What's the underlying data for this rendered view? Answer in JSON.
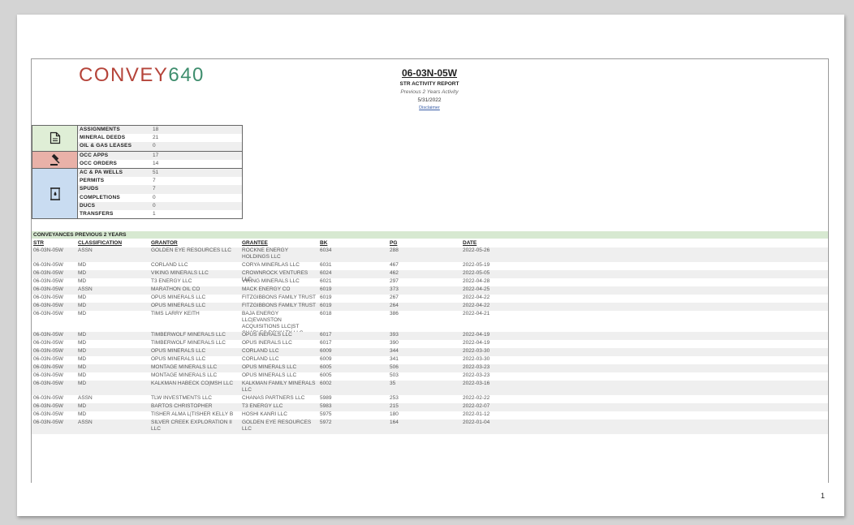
{
  "logo": {
    "part1": "CONVEY",
    "part2": "640"
  },
  "header": {
    "title": "06-03N-05W",
    "subtitle": "STR ACTIVITY REPORT",
    "note": "Previous 2 Years Activity",
    "date": "5/31/2022",
    "disclaimer": "Disclaimer"
  },
  "summary": {
    "groups": [
      {
        "icon": "document-icon",
        "color": "#dfeed6",
        "rows": [
          {
            "label": "ASSIGNMENTS",
            "value": "18"
          },
          {
            "label": "MINERAL DEEDS",
            "value": "21"
          },
          {
            "label": "OIL & GAS LEASES",
            "value": "0"
          }
        ]
      },
      {
        "icon": "gavel-icon",
        "color": "#e9b1a8",
        "rows": [
          {
            "label": "OCC APPS",
            "value": "17"
          },
          {
            "label": "OCC ORDERS",
            "value": "14"
          }
        ]
      },
      {
        "icon": "oil-barrel-icon",
        "color": "#c9dcf1",
        "rows": [
          {
            "label": "AC & PA WELLS",
            "value": "51"
          },
          {
            "label": "PERMITS",
            "value": "7"
          },
          {
            "label": "SPUDS",
            "value": "7"
          },
          {
            "label": "COMPLETIONS",
            "value": "0"
          },
          {
            "label": "DUCS",
            "value": "0"
          },
          {
            "label": "TRANSFERS",
            "value": "1"
          }
        ]
      }
    ]
  },
  "conveyances": {
    "title": "CONVEYANCES PREVIOUS 2 YEARS",
    "columns": [
      "STR",
      "CLASSIFICATION",
      "GRANTOR",
      "GRANTEE",
      "BK",
      "PG",
      "DATE"
    ],
    "rows": [
      [
        "06-03N-05W",
        "ASSN",
        "GOLDEN EYE RESOURCES LLC",
        "ROCKNE ENERGY HOLDINGS LLC",
        "6034",
        "288",
        "2022-05-26"
      ],
      [
        "06-03N-05W",
        "MD",
        "CORLAND LLC",
        "CORYA MINERLAS LLC",
        "6031",
        "467",
        "2022-05-19"
      ],
      [
        "06-03N-05W",
        "MD",
        "VIKING MINERALS LLC",
        "CROWNROCK VENTURES LLC",
        "6024",
        "462",
        "2022-05-05"
      ],
      [
        "06-03N-05W",
        "MD",
        "T3 ENERGY LLC",
        "VIKING MINERALS LLC",
        "6021",
        "297",
        "2022-04-28"
      ],
      [
        "06-03N-05W",
        "ASSN",
        "MARATHON OIL CO",
        "MACK ENERGY CO",
        "6019",
        "373",
        "2022-04-25"
      ],
      [
        "06-03N-05W",
        "MD",
        "OPUS MINERALS LLC",
        "FITZGIBBONS FAMILY TRUST",
        "6019",
        "267",
        "2022-04-22"
      ],
      [
        "06-03N-05W",
        "MD",
        "OPUS MINERALS LLC",
        "FITZGIBBONS FAMILY TRUST",
        "6019",
        "264",
        "2022-04-22"
      ],
      [
        "06-03N-05W",
        "MD",
        "TIMS LARRY KEITH",
        "BAJA ENERGY LLC|EVANSTON ACQUISITIONS LLC|ST CHARLES ROYALTY LLC",
        "6018",
        "386",
        "2022-04-21"
      ],
      [
        "06-03N-05W",
        "MD",
        "TIMBERWOLF MINERALS LLC",
        "OPUS INERALS LLC",
        "6017",
        "393",
        "2022-04-19"
      ],
      [
        "06-03N-05W",
        "MD",
        "TIMBERWOLF MINERALS LLC",
        "OPUS INERALS LLC",
        "6017",
        "390",
        "2022-04-19"
      ],
      [
        "06-03N-05W",
        "MD",
        "OPUS MINERALS LLC",
        "CORLAND LLC",
        "6009",
        "344",
        "2022-03-30"
      ],
      [
        "06-03N-05W",
        "MD",
        "OPUS MINERALS LLC",
        "CORLAND LLC",
        "6009",
        "341",
        "2022-03-30"
      ],
      [
        "06-03N-05W",
        "MD",
        "MONTAGE MINERALS LLC",
        "OPUS MINERALS LLC",
        "6005",
        "506",
        "2022-03-23"
      ],
      [
        "06-03N-05W",
        "MD",
        "MONTAGE MINERALS LLC",
        "OPUS MINERALS LLC",
        "6005",
        "503",
        "2022-03-23"
      ],
      [
        "06-03N-05W",
        "MD",
        "KALKMAN HABECK CO|MSH LLC",
        "KALKMAN FAMILY MINERALS LLC",
        "6002",
        "35",
        "2022-03-16"
      ],
      [
        "06-03N-05W",
        "ASSN",
        "TLW INVESTMENTS LLC",
        "CHANAS PARTNERS LLC",
        "5989",
        "253",
        "2022-02-22"
      ],
      [
        "06-03N-05W",
        "MD",
        "BARTOS CHRISTOPHER",
        "T3 ENERGY LLC",
        "5983",
        "215",
        "2022-02-07"
      ],
      [
        "06-03N-05W",
        "MD",
        "TISHER ALMA L|TISHER KELLY B",
        "HOSHI KANRI LLC",
        "5975",
        "180",
        "2022-01-12"
      ],
      [
        "06-03N-05W",
        "ASSN",
        "SILVER CREEK EXPLORATION II LLC",
        "GOLDEN EYE RESOURCES LLC",
        "5972",
        "164",
        "2022-01-04"
      ]
    ]
  },
  "page_number": "1"
}
